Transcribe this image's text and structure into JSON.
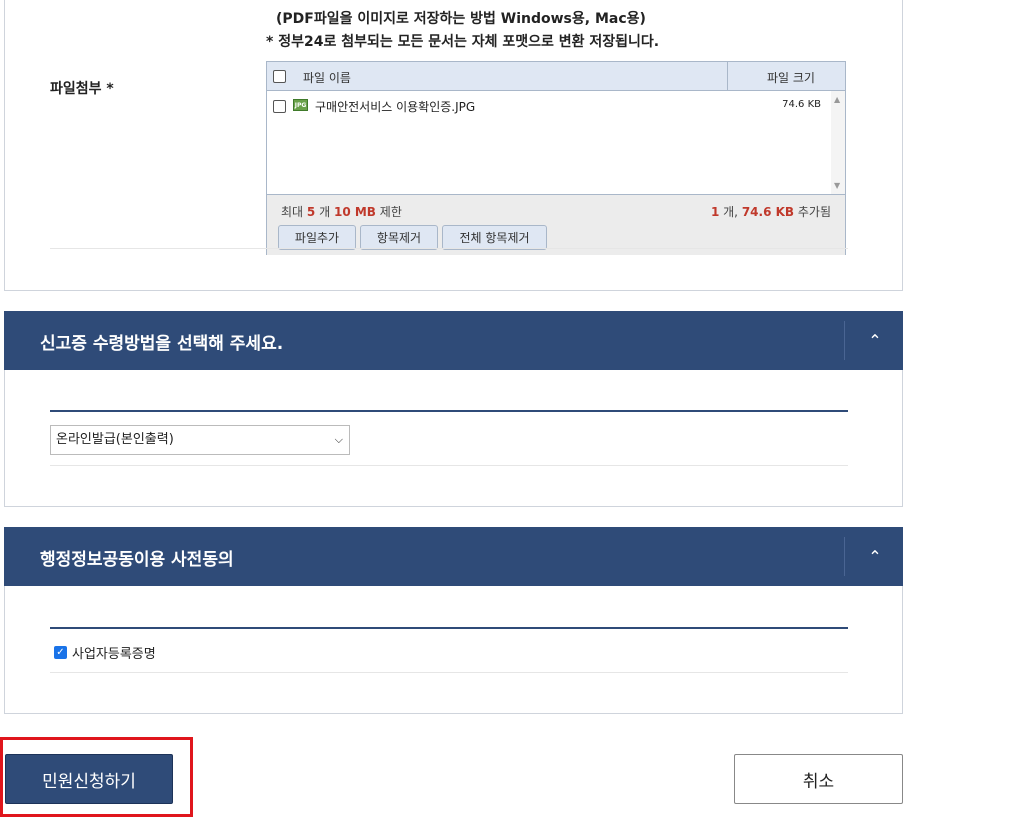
{
  "attachment": {
    "note1": "(PDF파일을 이미지로 저장하는 방법  Windows용, Mac용)",
    "note2": "* 정부24로 첨부되는 모든 문서는 자체 포맷으로 변환 저장됩니다.",
    "label": "파일첨부 *",
    "columns": {
      "name": "파일 이름",
      "size": "파일 크기"
    },
    "files": [
      {
        "name": "구매안전서비스 이용확인증.JPG",
        "size": "74.6 KB",
        "icon": "jpg-file-icon"
      }
    ],
    "limit": {
      "prefix": "최대",
      "count": "5",
      "count_unit": "개",
      "size": "10 MB",
      "suffix": "제한"
    },
    "added": {
      "count": "1",
      "count_unit": "개,",
      "size": "74.6 KB",
      "suffix": "추가됨"
    },
    "buttons": {
      "add": "파일추가",
      "remove": "항목제거",
      "remove_all": "전체 항목제거"
    }
  },
  "receipt": {
    "title": "신고증 수령방법을 선택해 주세요.",
    "selected": "온라인발급(본인출력)"
  },
  "consent": {
    "title": "행정정보공동이용 사전동의",
    "item_label": "사업자등록증명",
    "checked": true
  },
  "actions": {
    "submit": "민원신청하기",
    "cancel": "취소"
  },
  "colors": {
    "header_bg": "#2f4b78",
    "highlight": "#e0161c",
    "accent_red": "#c0392b"
  }
}
